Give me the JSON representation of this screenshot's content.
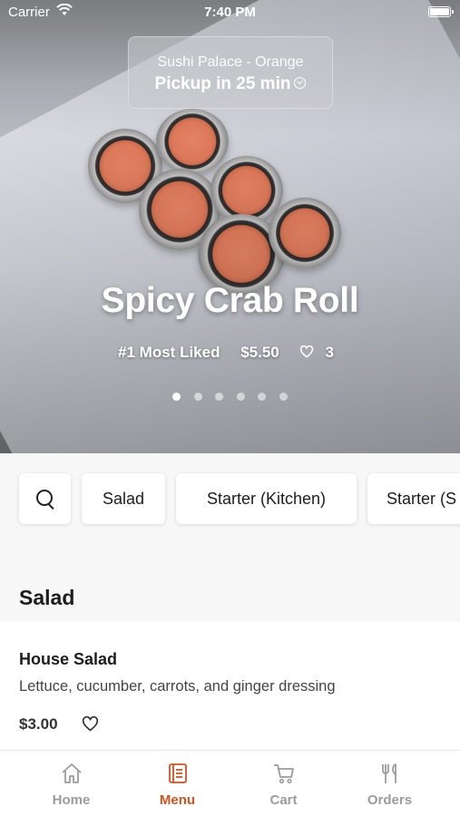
{
  "status_bar": {
    "carrier": "Carrier",
    "time": "7:40 PM"
  },
  "hero": {
    "location": "Sushi Palace - Orange",
    "pickup": "Pickup in 25 min",
    "dish_name": "Spicy Crab Roll",
    "rank": "#1 Most Liked",
    "price": "$5.50",
    "likes": "3",
    "carousel": {
      "count": 6,
      "active_index": 0
    }
  },
  "categories": [
    {
      "label": "Salad"
    },
    {
      "label": "Starter (Kitchen)"
    },
    {
      "label": "Starter (S"
    }
  ],
  "section": {
    "title": "Salad"
  },
  "items": [
    {
      "name": "House Salad",
      "description": "Lettuce, cucumber, carrots, and ginger dressing",
      "price": "$3.00"
    }
  ],
  "tabs": [
    {
      "label": "Home",
      "icon": "home-icon",
      "active": false
    },
    {
      "label": "Menu",
      "icon": "menu-icon",
      "active": true
    },
    {
      "label": "Cart",
      "icon": "cart-icon",
      "active": false
    },
    {
      "label": "Orders",
      "icon": "fork-knife-icon",
      "active": false
    }
  ],
  "colors": {
    "accent": "#d5521f",
    "inactive_tab": "#9c9c9c"
  }
}
